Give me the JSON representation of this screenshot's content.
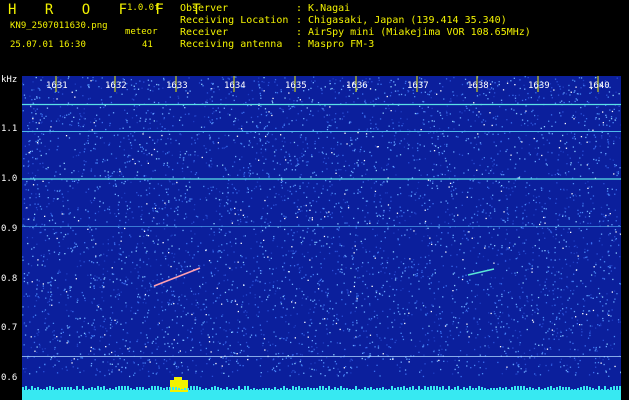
{
  "header": {
    "app_title": "H R O F F T",
    "version": "1.0.0f",
    "filename": "KN9_2507011630.png",
    "datetime": "25.07.01 16:30",
    "meteor_label": "meteor",
    "meteor_count": "41"
  },
  "info": {
    "observer_label": "Observer",
    "observer_value": ": K.Nagai",
    "location_label": "Receiving Location",
    "location_value": ": Chigasaki, Japan (139.414 35.340)",
    "receiver_label": "Receiver",
    "receiver_value": ": AirSpy mini (Miakejima VOR 108.65MHz)",
    "antenna_label": "Receiving antenna",
    "antenna_value": ": Maspro FM-3"
  },
  "spectrogram": {
    "y_unit": "kHz",
    "y_ticks": [
      "1.1",
      "1.0",
      "0.9",
      "0.8",
      "0.7",
      "0.6"
    ],
    "x_ticks": [
      "1631",
      "1632",
      "1633",
      "1634",
      "1635",
      "1636",
      "1637",
      "1638",
      "1639",
      "1640"
    ],
    "background_color": "#0b1f9c",
    "tick_color": "#f2f200",
    "signal_color": "#56e6e6"
  }
}
